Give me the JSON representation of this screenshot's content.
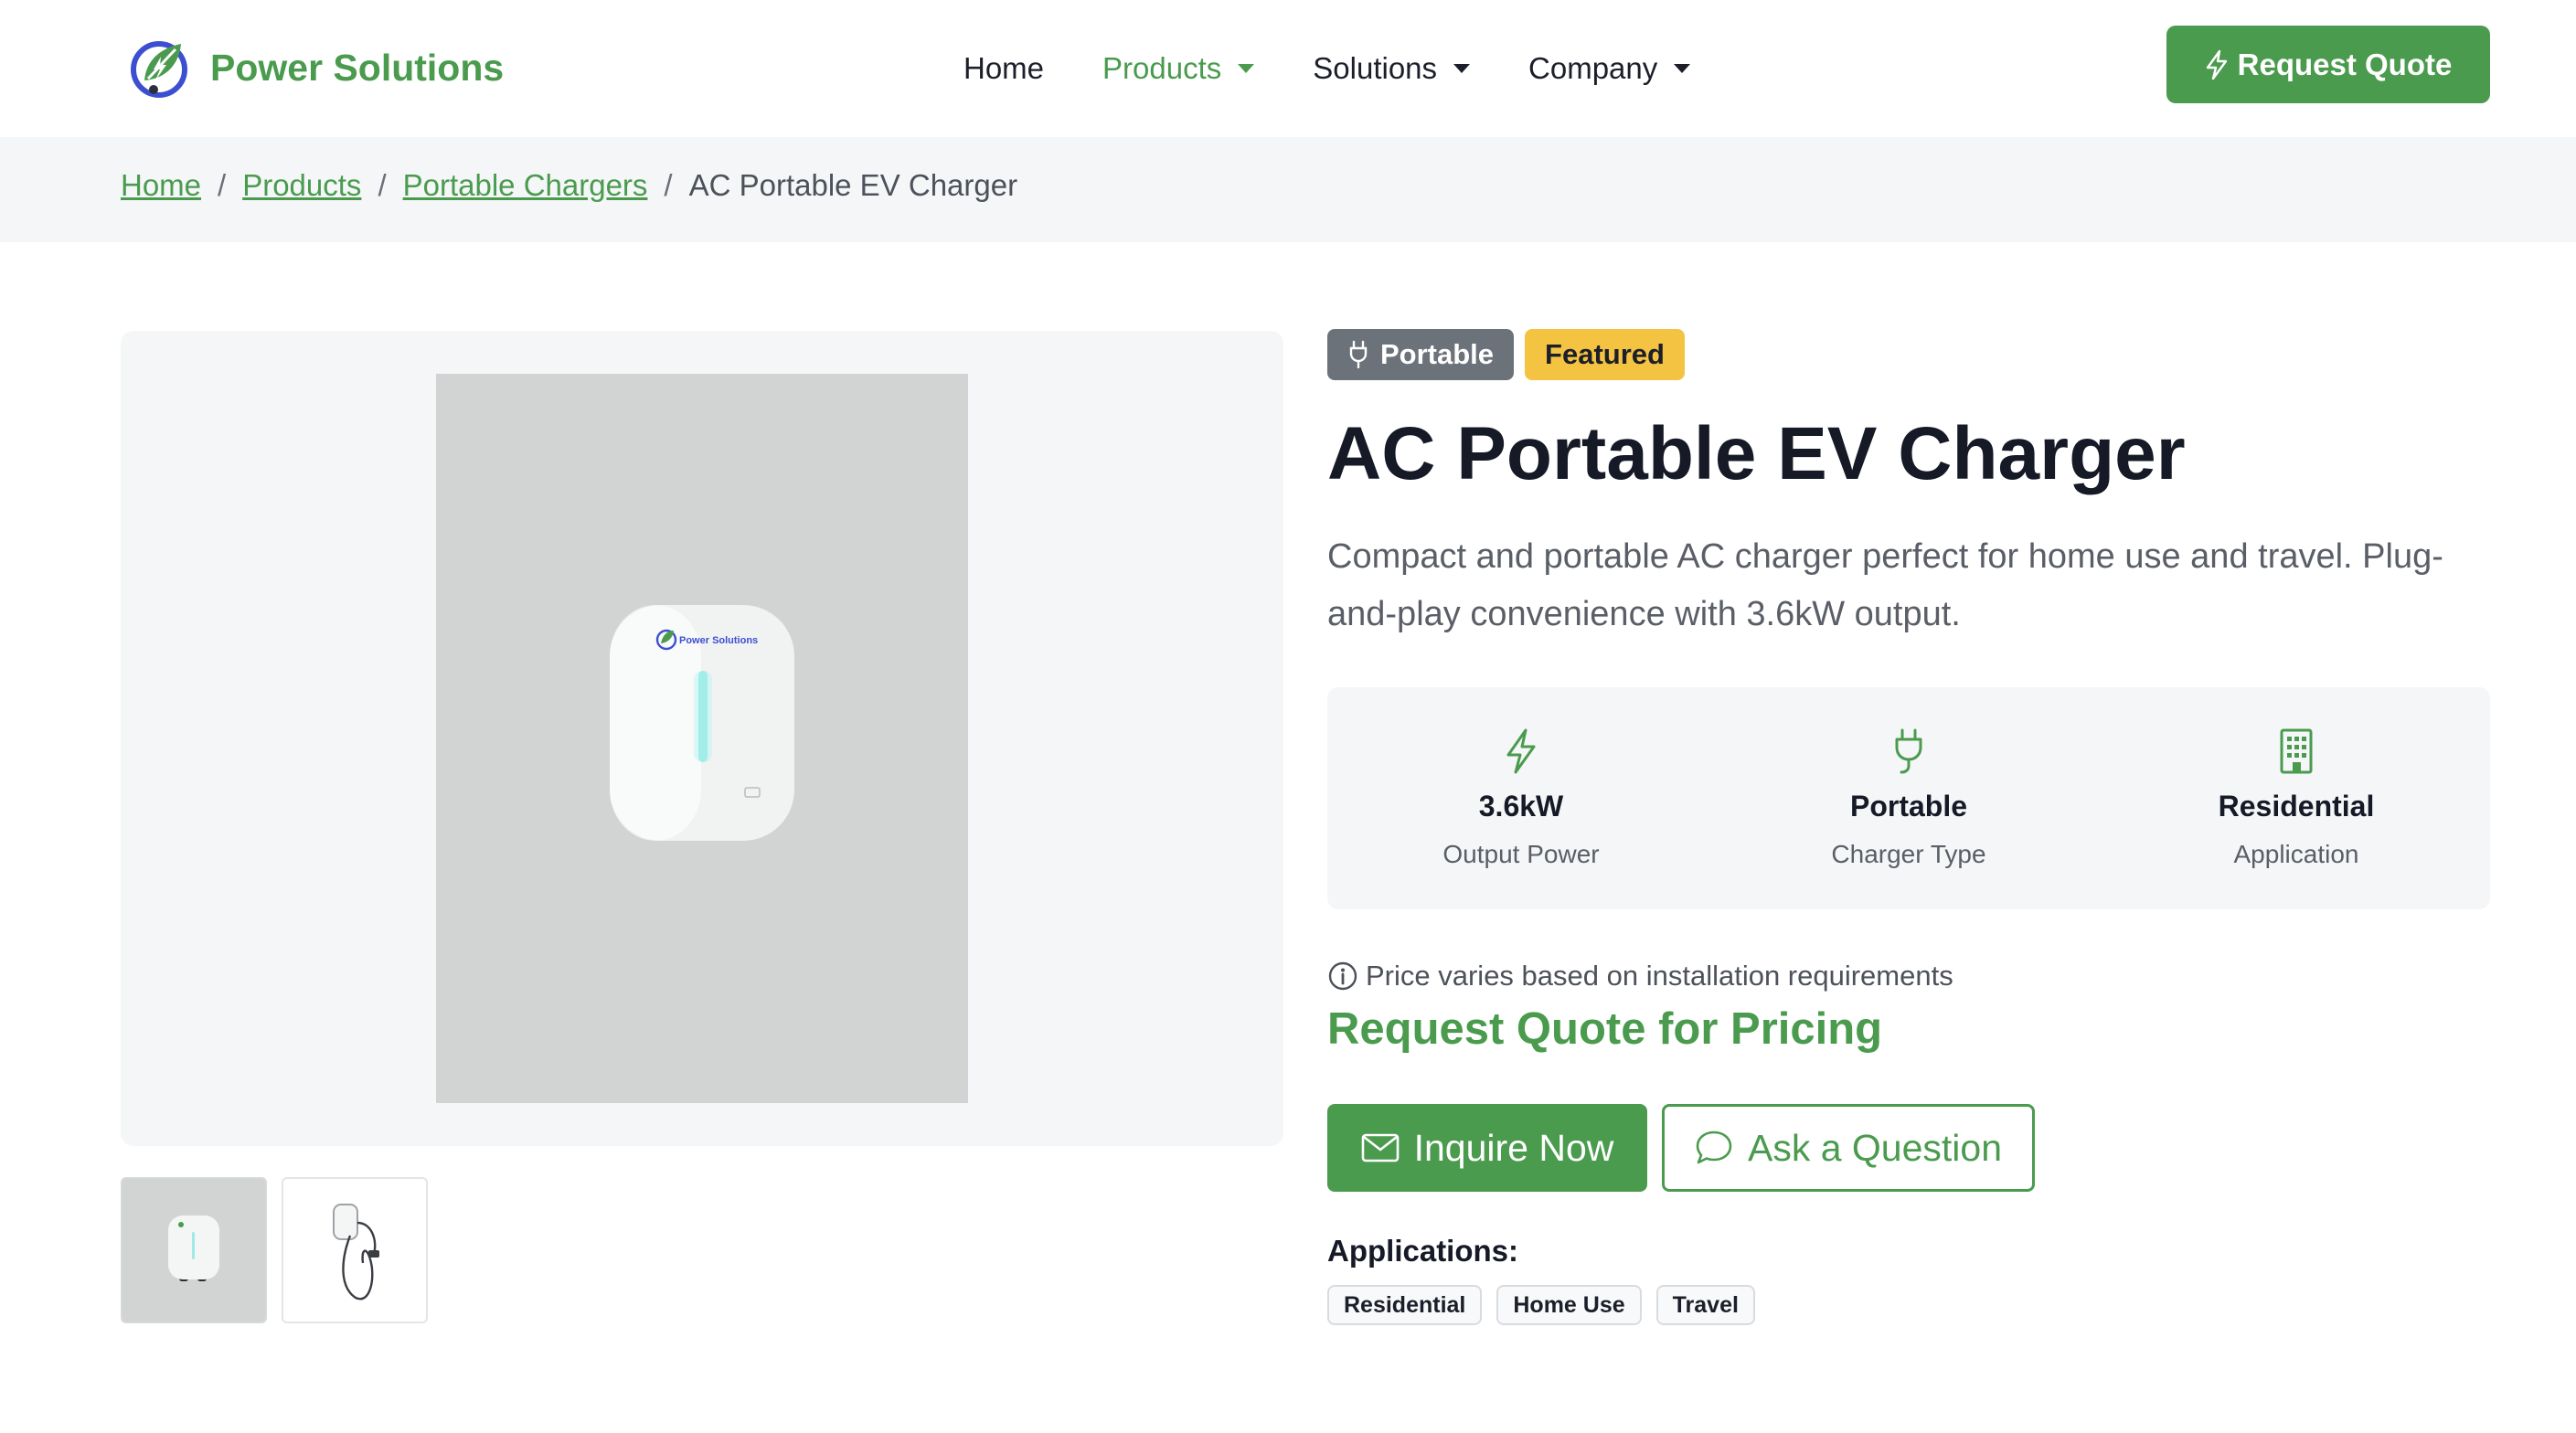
{
  "brand": {
    "name": "Power Solutions"
  },
  "nav": {
    "items": [
      {
        "label": "Home"
      },
      {
        "label": "Products"
      },
      {
        "label": "Solutions"
      },
      {
        "label": "Company"
      }
    ],
    "cta_label": "Request Quote"
  },
  "breadcrumb": {
    "links": [
      "Home",
      "Products",
      "Portable Chargers"
    ],
    "separator": "/",
    "current": "AC Portable EV Charger"
  },
  "product": {
    "badges": {
      "portable": "Portable",
      "featured": "Featured"
    },
    "title": "AC Portable EV Charger",
    "description": "Compact and portable AC charger perfect for home use and travel. Plug-and-play convenience with 3.6kW output.",
    "specs": [
      {
        "icon": "lightning-icon",
        "value": "3.6kW",
        "label": "Output Power"
      },
      {
        "icon": "plug-icon",
        "value": "Portable",
        "label": "Charger Type"
      },
      {
        "icon": "building-icon",
        "value": "Residential",
        "label": "Application"
      }
    ],
    "price_note": "Price varies based on installation requirements",
    "price_cta": "Request Quote for Pricing",
    "inquire_label": "Inquire Now",
    "ask_label": "Ask a Question",
    "applications_title": "Applications:",
    "applications": [
      "Residential",
      "Home Use",
      "Travel"
    ],
    "device_logo_text": "Power Solutions"
  },
  "colors": {
    "accent": "#4a9b4e",
    "badge_portable": "#6c727a",
    "badge_featured": "#f5c342",
    "surface": "#f5f6f8"
  }
}
